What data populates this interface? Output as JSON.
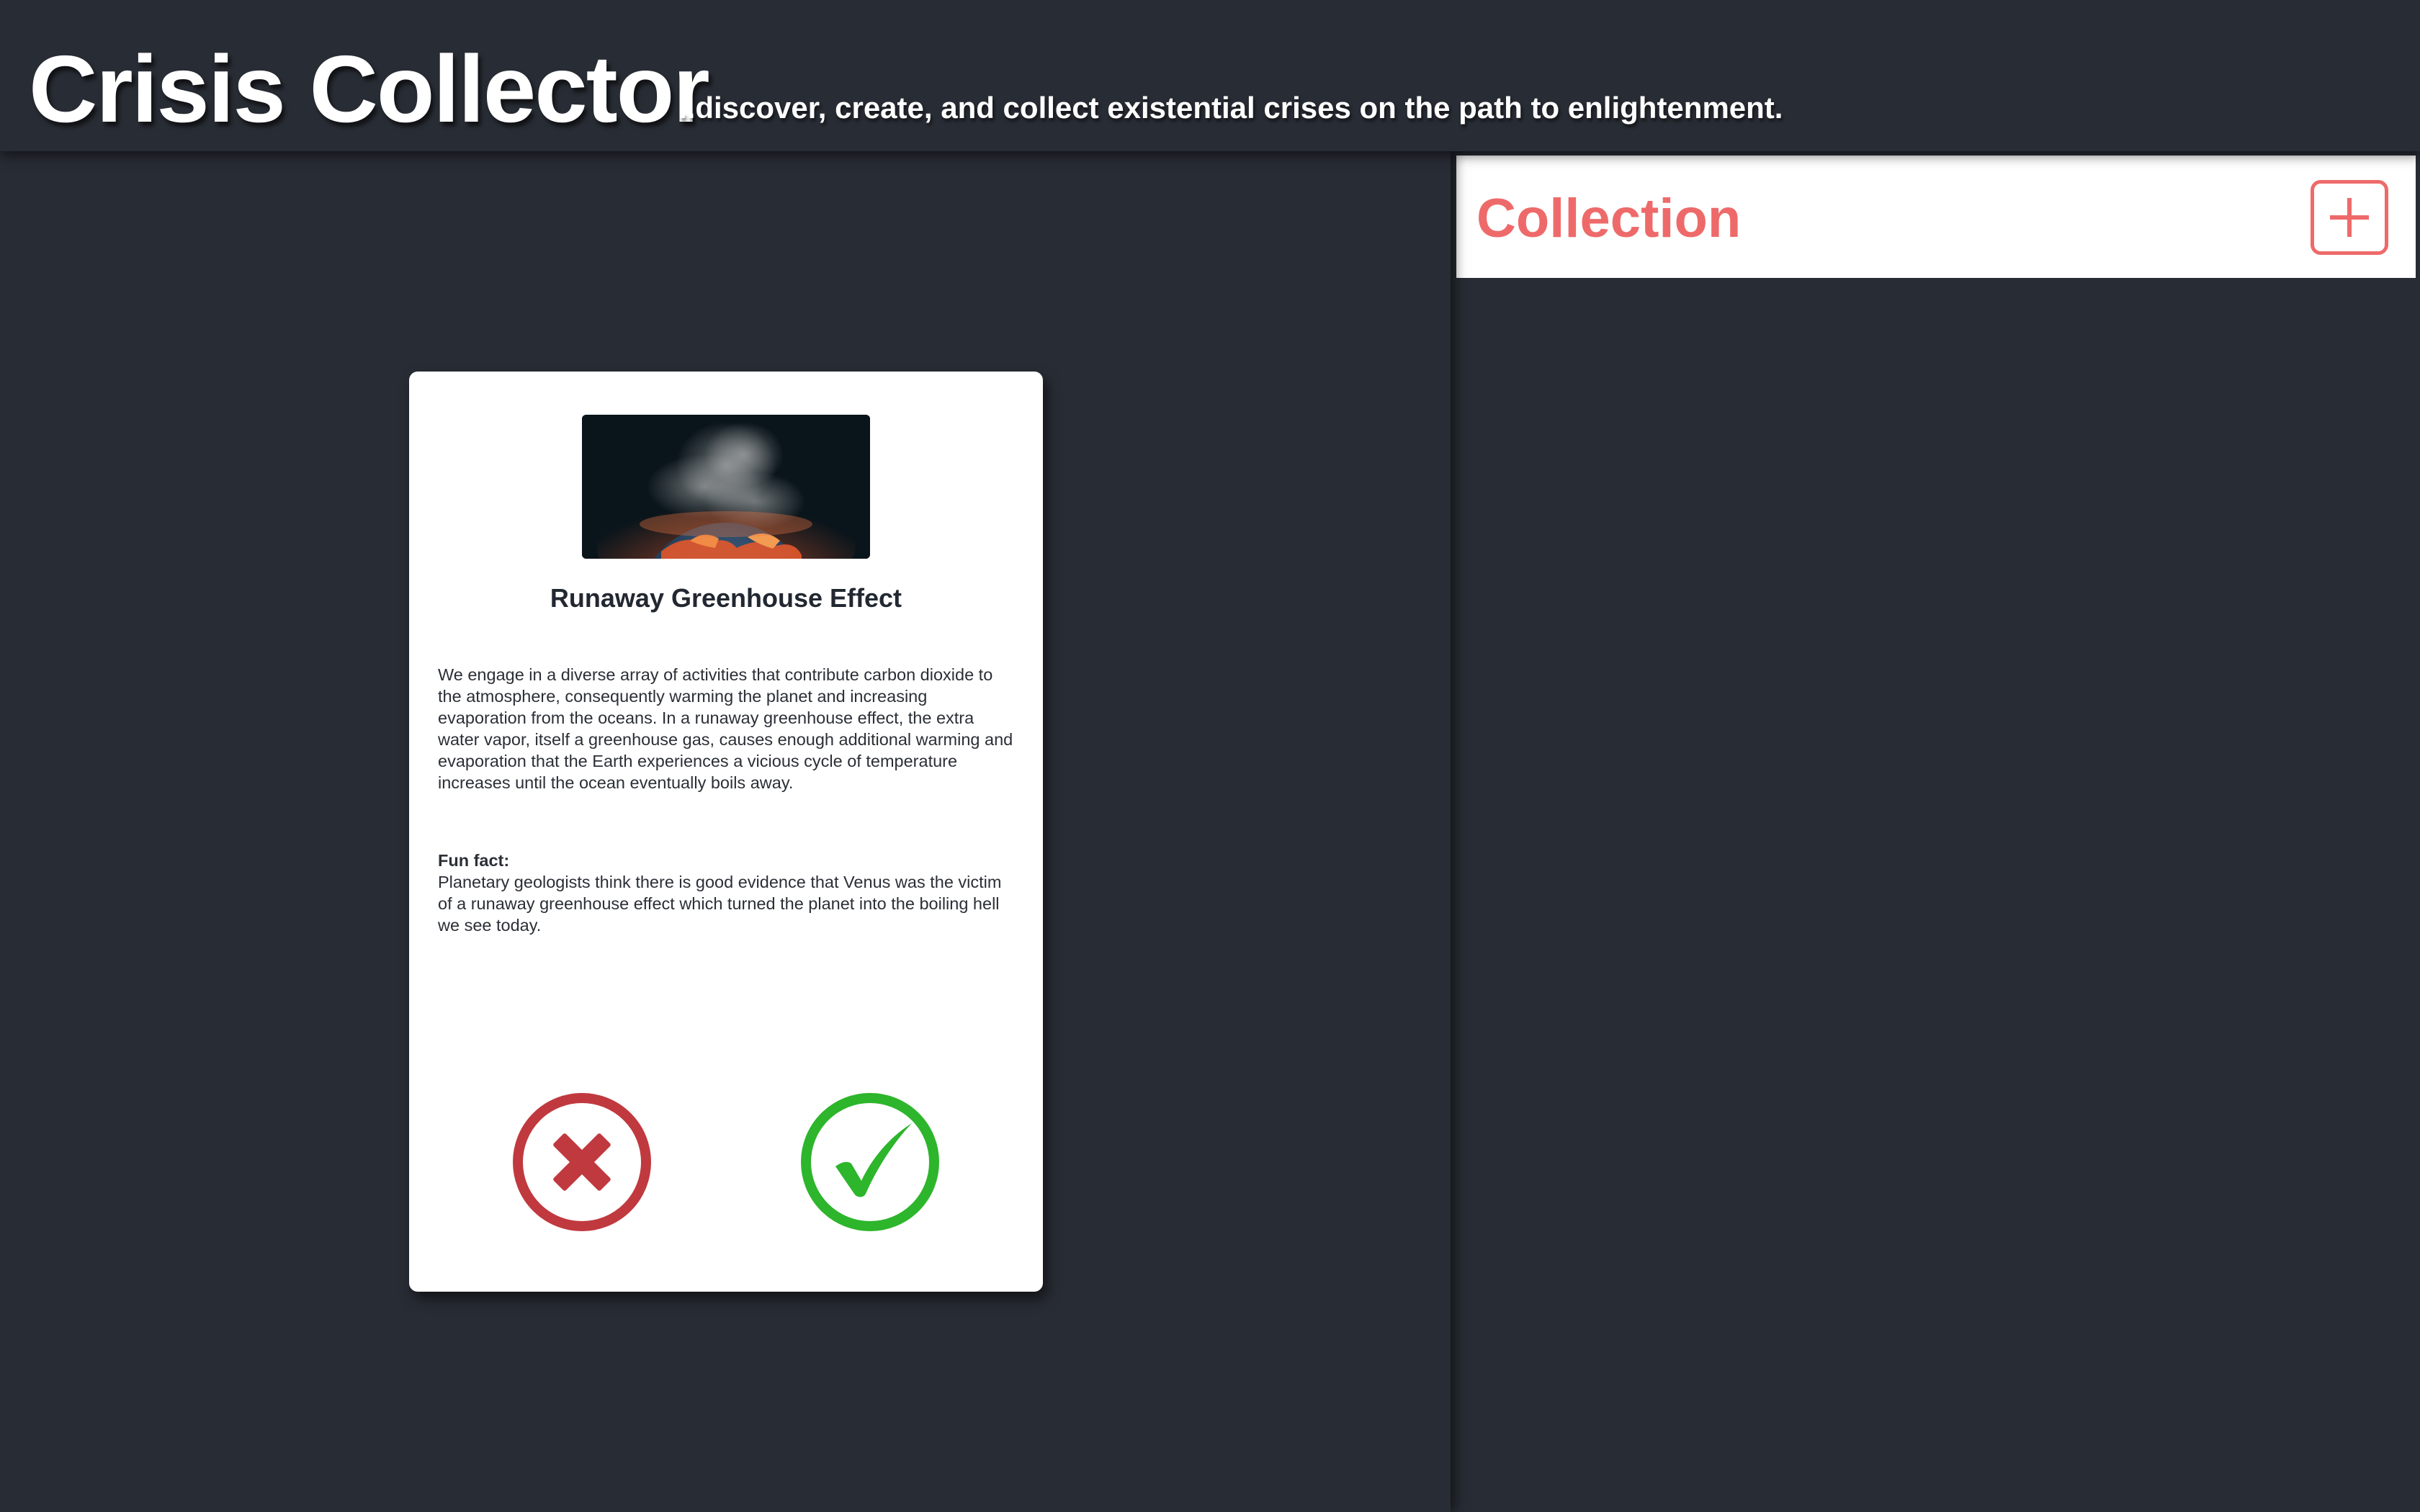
{
  "header": {
    "title": "Crisis Collector",
    "subtitle": "..discover, create, and collect existential crises on the path to enlightenment."
  },
  "card": {
    "image_icon": "burning-earth-image",
    "title": "Runaway Greenhouse Effect",
    "description": "We engage in a diverse array of activities that contribute carbon dioxide to the atmosphere, consequently warming the planet and increasing evaporation from the oceans. In a runaway greenhouse effect, the extra water vapor, itself a greenhouse gas, causes enough additional warming and evaporation that the Earth experiences a vicious cycle of temperature increases until the ocean eventually boils away.",
    "fun_fact_label": "Fun fact:",
    "fun_fact": "Planetary geologists think there is good evidence that Venus was the victim of a runaway greenhouse effect which turned the planet into the boiling hell we see today.",
    "reject_icon": "x-circle-icon",
    "accept_icon": "check-circle-icon"
  },
  "sidebar": {
    "title": "Collection",
    "add_icon": "plus-icon"
  },
  "colors": {
    "background": "#282c34",
    "accent": "#ee6a6a",
    "reject": "#c0393f",
    "accept": "#2db52b"
  }
}
